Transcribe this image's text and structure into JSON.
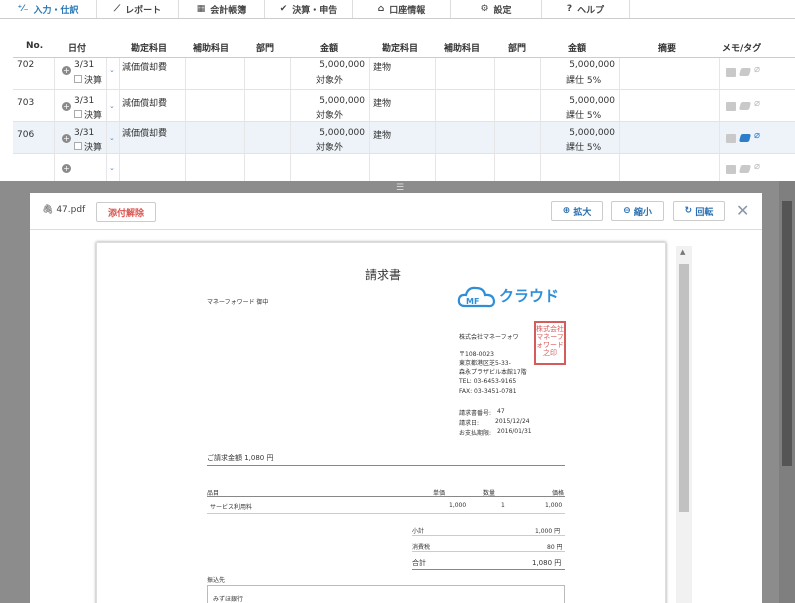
{
  "nav": [
    {
      "icon": "⁺⁄₋",
      "label": "入力・仕訳"
    },
    {
      "icon": "⟋",
      "label": "レポート"
    },
    {
      "icon": "▦",
      "label": "会計帳簿"
    },
    {
      "icon": "✔",
      "label": "決算・申告"
    },
    {
      "icon": "⌂",
      "label": "口座情報"
    },
    {
      "icon": "⚙",
      "label": "設定"
    },
    {
      "icon": "?",
      "label": "ヘルプ"
    }
  ],
  "table": {
    "headers": [
      "No.",
      "日付",
      "勘定科目",
      "補助科目",
      "部門",
      "金額",
      "勘定科目",
      "補助科目",
      "部門",
      "金額",
      "摘要",
      "メモ/タグ"
    ],
    "settle_label": "決算",
    "rows": [
      {
        "no": "702",
        "date": "3/31",
        "debit_account": "減価償却費",
        "debit_amount": "5,000,000",
        "debit_tax": "対象外",
        "credit_account": "建物",
        "credit_amount": "5,000,000",
        "credit_tax": "課仕 5%"
      },
      {
        "no": "703",
        "date": "3/31",
        "debit_account": "減価償却費",
        "debit_amount": "5,000,000",
        "debit_tax": "対象外",
        "credit_account": "建物",
        "credit_amount": "5,000,000",
        "credit_tax": "課仕 5%"
      },
      {
        "no": "706",
        "date": "3/31",
        "debit_account": "減価償却費",
        "debit_amount": "5,000,000",
        "debit_tax": "対象外",
        "credit_account": "建物",
        "credit_amount": "5,000,000",
        "credit_tax": "課仕 5%"
      }
    ]
  },
  "modal": {
    "filename": "47.pdf",
    "detach_label": "添付解除",
    "zoom_in_label": "拡大",
    "zoom_out_label": "縮小",
    "rotate_label": "回転"
  },
  "invoice": {
    "title": "請求書",
    "recipient": "マネーフォワード 御中",
    "logo_text": "クラウド",
    "logo_mark": "MF",
    "company": "株式会社マネーフォワ",
    "zip": "〒108-0023",
    "address1": "東京都港区芝5-33-",
    "address2": "森永プラザビル本館17階",
    "tel": "TEL: 03-6453-9165",
    "fax": "FAX: 03-3451-0781",
    "invoice_no_label": "請求書番号:",
    "invoice_no": "47",
    "date_label": "請求日:",
    "date": "2015/12/24",
    "due_label": "お支払期限:",
    "due": "2016/01/31",
    "total_line": "ご請求金額 1,080 円",
    "col_item": "品目",
    "col_price": "単価",
    "col_qty": "数量",
    "col_amount": "価格",
    "item_name": "サービス利用料",
    "item_price": "1,000",
    "item_qty": "1",
    "item_amount": "1,000",
    "subtotal_label": "小計",
    "subtotal": "1,000 円",
    "tax_label": "消費税",
    "tax": "80 円",
    "total_label": "合計",
    "total": "1,080 円",
    "bank_label": "振込先",
    "bank_name": "みずほ銀行",
    "seal_text": "株式会社マネーフォワード之印"
  }
}
